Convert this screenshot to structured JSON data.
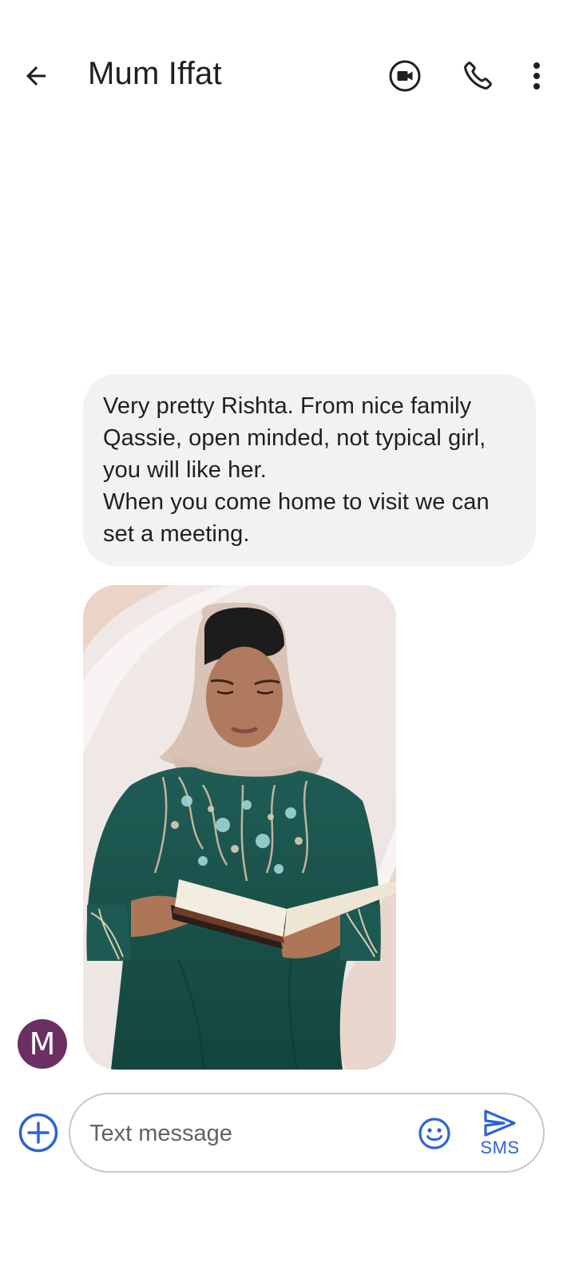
{
  "header": {
    "contact_name": "Mum Iffat",
    "icons": [
      "back-arrow-icon",
      "video-call-icon",
      "phone-icon",
      "more-vert-icon"
    ]
  },
  "conversation": {
    "messages": [
      {
        "sender": "M",
        "type": "text",
        "text": "Very pretty Rishta. From nice family\nQassie, open minded, not typical girl,\nyou will like her.\nWhen you come home to visit we can\nset a meeting."
      },
      {
        "sender": "M",
        "type": "image"
      }
    ],
    "avatar_initial": "M",
    "avatar_color": "#6b2f63"
  },
  "compose": {
    "placeholder": "Text message",
    "send_label": "SMS",
    "accent_color": "#2f63d6"
  }
}
